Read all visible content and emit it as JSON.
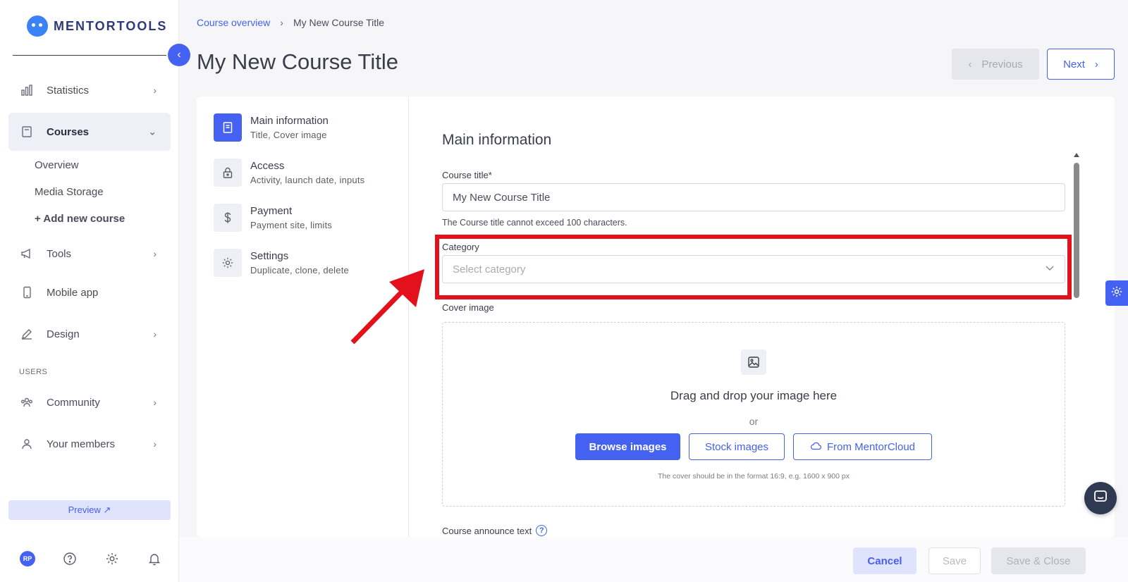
{
  "app": {
    "logo_text": "MENTORTOOLS"
  },
  "sidebar": {
    "items": [
      {
        "label": "Statistics",
        "icon": "bar-chart-icon"
      },
      {
        "label": "Courses",
        "icon": "book-icon"
      },
      {
        "label": "Tools",
        "icon": "megaphone-icon"
      },
      {
        "label": "Mobile app",
        "icon": "phone-icon"
      },
      {
        "label": "Design",
        "icon": "pen-icon"
      },
      {
        "label": "Community",
        "icon": "community-icon"
      },
      {
        "label": "Your members",
        "icon": "user-icon"
      }
    ],
    "sub_items": [
      "Overview",
      "Media Storage",
      "+ Add new course"
    ],
    "section_users": "USERS",
    "preview_label": "Preview ↗",
    "avatar_initials": "RP"
  },
  "breadcrumb": {
    "link": "Course overview",
    "current": "My New Course Title"
  },
  "page": {
    "title": "My New Course Title"
  },
  "nav_buttons": {
    "previous": "Previous",
    "next": "Next"
  },
  "steps": [
    {
      "title": "Main information",
      "sub": "Title, Cover image",
      "icon": "book-icon"
    },
    {
      "title": "Access",
      "sub": "Activity, launch date, inputs",
      "icon": "lock-icon"
    },
    {
      "title": "Payment",
      "sub": "Payment site, limits",
      "icon": "dollar-icon"
    },
    {
      "title": "Settings",
      "sub": "Duplicate, clone, delete",
      "icon": "gear-icon"
    }
  ],
  "form": {
    "title": "Main information",
    "course_title_label": "Course title*",
    "course_title_value": "My New Course Title",
    "course_title_hint": "The Course title cannot exceed 100 characters.",
    "category_label": "Category",
    "category_placeholder": "Select category",
    "cover_label": "Cover image",
    "drop_title": "Drag and drop your image here",
    "drop_or": "or",
    "browse_btn": "Browse images",
    "stock_btn": "Stock images",
    "cloud_btn": "From MentorCloud",
    "drop_hint": "The cover should be in the format 16:9, e.g. 1600 x 900 px",
    "announce_label": "Course announce text",
    "announce_help": "?"
  },
  "footer_buttons": {
    "cancel": "Cancel",
    "save": "Save",
    "save_close": "Save & Close"
  },
  "colors": {
    "accent": "#4461f2",
    "highlight": "#e3111b",
    "chat": "#2f3a52"
  }
}
